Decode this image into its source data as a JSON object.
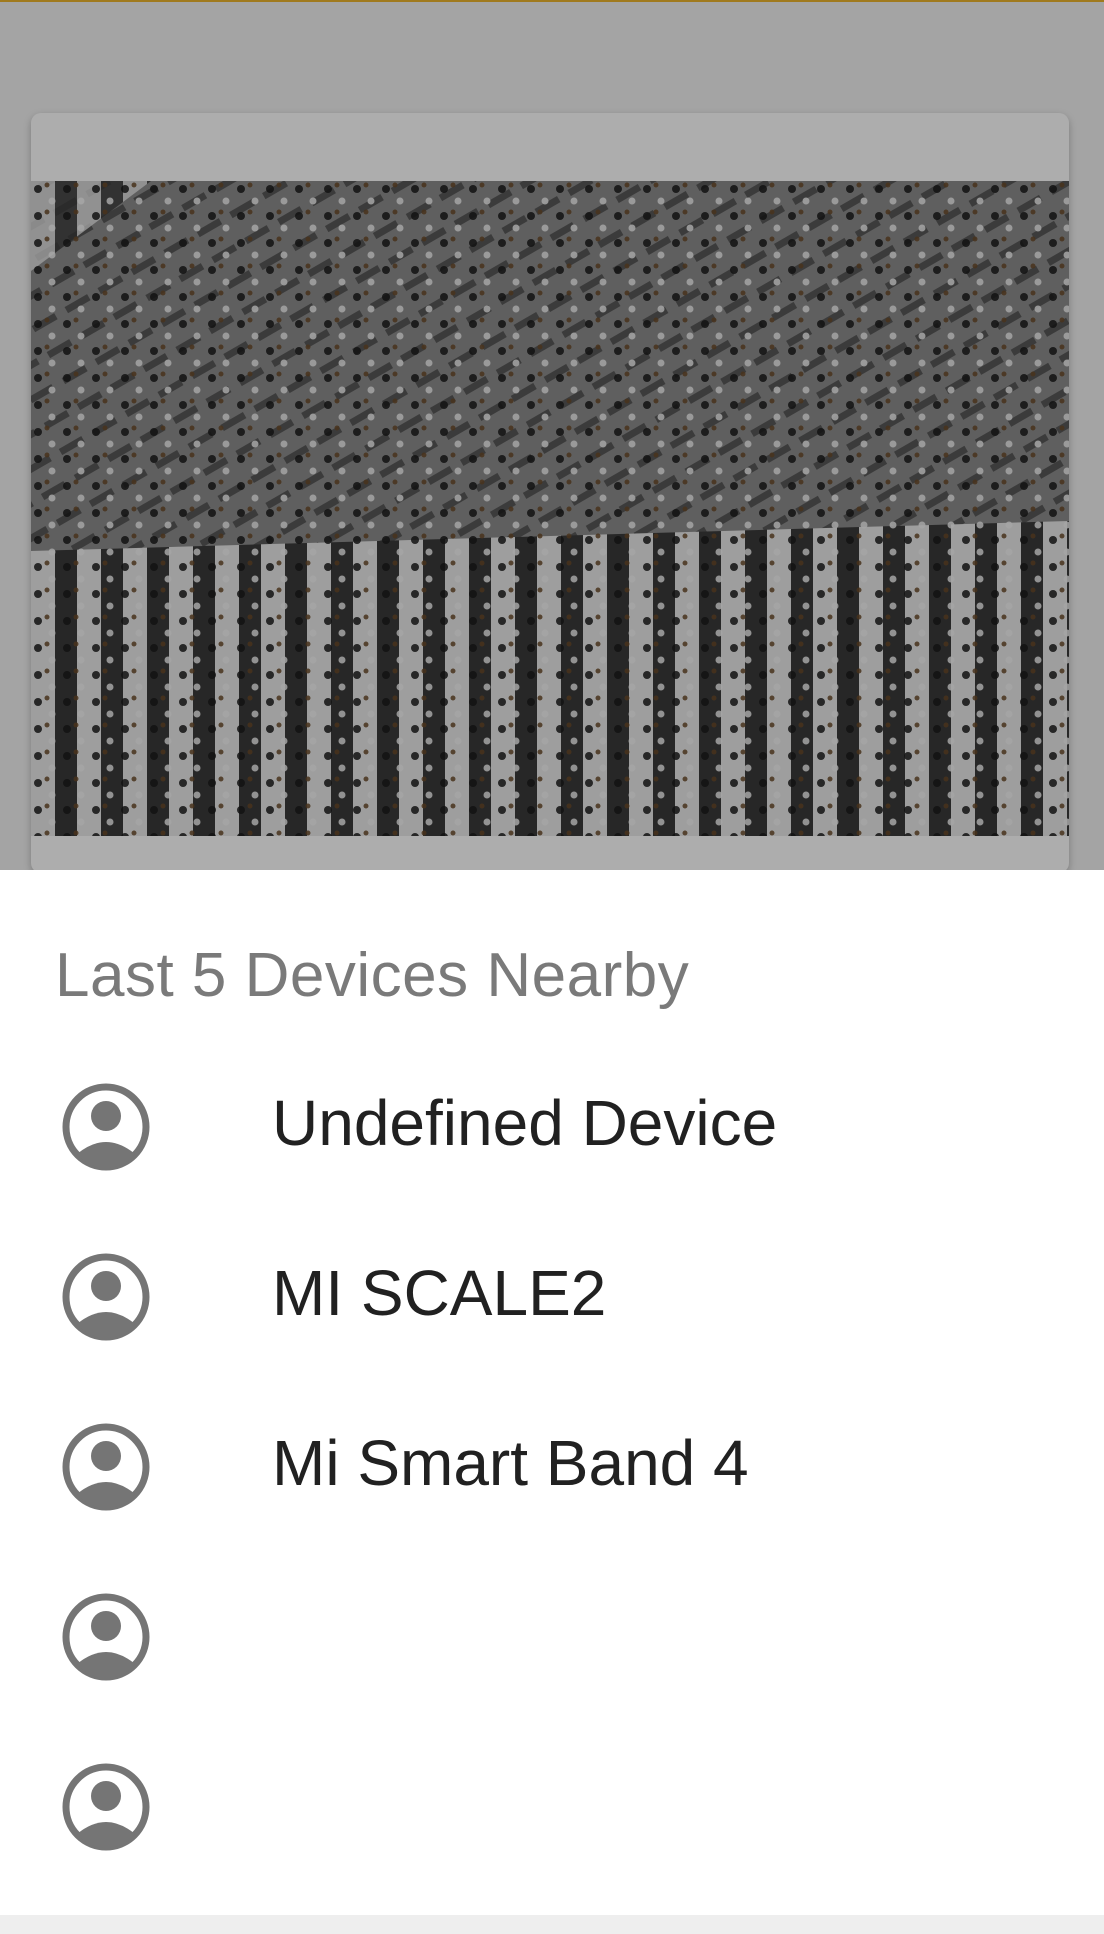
{
  "sheet": {
    "title": "Last 5 Devices Nearby"
  },
  "devices": [
    {
      "name": "Undefined Device",
      "icon": "account-circle-icon"
    },
    {
      "name": "MI SCALE2",
      "icon": "account-circle-icon"
    },
    {
      "name": "Mi Smart Band 4",
      "icon": "account-circle-icon"
    },
    {
      "name": "",
      "icon": "account-circle-icon"
    },
    {
      "name": "",
      "icon": "account-circle-icon"
    }
  ],
  "colors": {
    "scrim": "rgba(0,0,0,0.32)",
    "title": "#7a7a7a",
    "item_text": "#212121",
    "icon": "#757575",
    "accent_border": "#a07a1e"
  }
}
